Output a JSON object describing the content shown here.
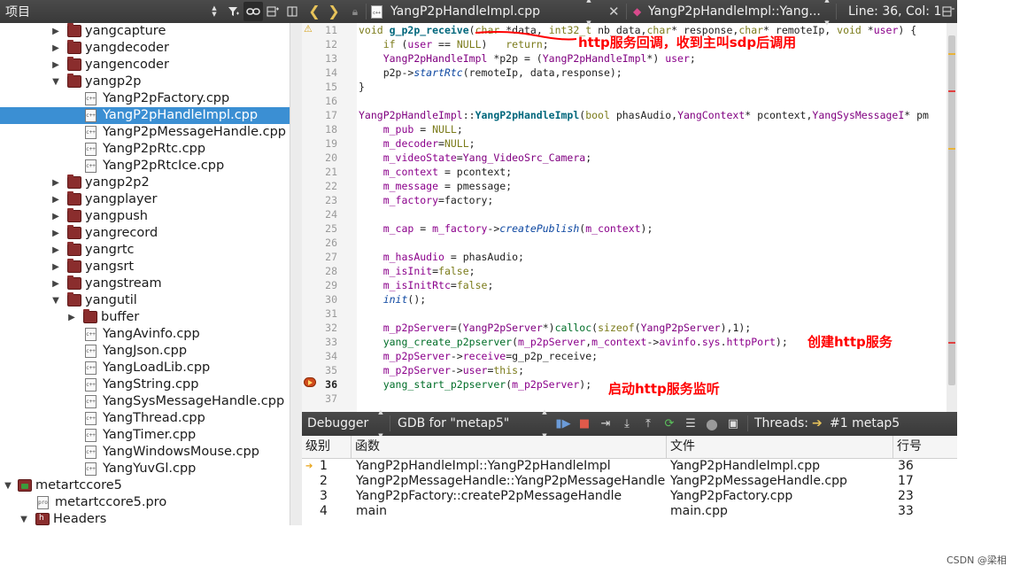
{
  "project_pane": {
    "title": "项目",
    "tree": [
      {
        "label": "yangcapture",
        "type": "folder",
        "depth": 1,
        "expanded": false
      },
      {
        "label": "yangdecoder",
        "type": "folder",
        "depth": 1,
        "expanded": false
      },
      {
        "label": "yangencoder",
        "type": "folder",
        "depth": 1,
        "expanded": false
      },
      {
        "label": "yangp2p",
        "type": "folder",
        "depth": 1,
        "expanded": true
      },
      {
        "label": "YangP2pFactory.cpp",
        "type": "file",
        "depth": 2
      },
      {
        "label": "YangP2pHandleImpl.cpp",
        "type": "file",
        "depth": 2,
        "selected": true
      },
      {
        "label": "YangP2pMessageHandle.cpp",
        "type": "file",
        "depth": 2
      },
      {
        "label": "YangP2pRtc.cpp",
        "type": "file",
        "depth": 2
      },
      {
        "label": "YangP2pRtcIce.cpp",
        "type": "file",
        "depth": 2
      },
      {
        "label": "yangp2p2",
        "type": "folder",
        "depth": 1,
        "expanded": false
      },
      {
        "label": "yangplayer",
        "type": "folder",
        "depth": 1,
        "expanded": false
      },
      {
        "label": "yangpush",
        "type": "folder",
        "depth": 1,
        "expanded": false
      },
      {
        "label": "yangrecord",
        "type": "folder",
        "depth": 1,
        "expanded": false
      },
      {
        "label": "yangrtc",
        "type": "folder",
        "depth": 1,
        "expanded": false
      },
      {
        "label": "yangsrt",
        "type": "folder",
        "depth": 1,
        "expanded": false
      },
      {
        "label": "yangstream",
        "type": "folder",
        "depth": 1,
        "expanded": false
      },
      {
        "label": "yangutil",
        "type": "folder",
        "depth": 1,
        "expanded": true
      },
      {
        "label": "buffer",
        "type": "folder",
        "depth": 2,
        "expanded": false
      },
      {
        "label": "YangAvinfo.cpp",
        "type": "file",
        "depth": 2
      },
      {
        "label": "YangJson.cpp",
        "type": "file",
        "depth": 2
      },
      {
        "label": "YangLoadLib.cpp",
        "type": "file",
        "depth": 2
      },
      {
        "label": "YangString.cpp",
        "type": "file",
        "depth": 2
      },
      {
        "label": "YangSysMessageHandle.cpp",
        "type": "file",
        "depth": 2
      },
      {
        "label": "YangThread.cpp",
        "type": "file",
        "depth": 2
      },
      {
        "label": "YangTimer.cpp",
        "type": "file",
        "depth": 2
      },
      {
        "label": "YangWindowsMouse.cpp",
        "type": "file",
        "depth": 2
      },
      {
        "label": "YangYuvGl.cpp",
        "type": "file",
        "depth": 2
      },
      {
        "label": "metartccore5",
        "type": "project",
        "depth": 0,
        "expanded": true
      },
      {
        "label": "metartccore5.pro",
        "type": "pro",
        "depth": 1
      },
      {
        "label": "Headers",
        "type": "headers",
        "depth": 1,
        "expanded": true
      }
    ]
  },
  "editor": {
    "file_tab": "YangP2pHandleImpl.cpp",
    "symbol": "YangP2pHandleImpl::Yang...",
    "position": "Line: 36, Col: 1",
    "lines": [
      {
        "no": "11",
        "text": "void g_p2p_receive(char *data, int32_t nb_data,char* response,char* remoteIp, void *user) {"
      },
      {
        "no": "12",
        "text": "    if (user == NULL)   return;"
      },
      {
        "no": "13",
        "text": "    YangP2pHandleImpl *p2p = (YangP2pHandleImpl*) user;"
      },
      {
        "no": "14",
        "text": "    p2p->startRtc(remoteIp, data,response);"
      },
      {
        "no": "15",
        "text": "}"
      },
      {
        "no": "16",
        "text": ""
      },
      {
        "no": "17",
        "text": "YangP2pHandleImpl::YangP2pHandleImpl(bool phasAudio,YangContext* pcontext,YangSysMessageI* pm"
      },
      {
        "no": "18",
        "text": "    m_pub = NULL;"
      },
      {
        "no": "19",
        "text": "    m_decoder=NULL;"
      },
      {
        "no": "20",
        "text": "    m_videoState=Yang_VideoSrc_Camera;"
      },
      {
        "no": "21",
        "text": "    m_context = pcontext;"
      },
      {
        "no": "22",
        "text": "    m_message = pmessage;"
      },
      {
        "no": "23",
        "text": "    m_factory=factory;"
      },
      {
        "no": "24",
        "text": ""
      },
      {
        "no": "25",
        "text": "    m_cap = m_factory->createPublish(m_context);"
      },
      {
        "no": "26",
        "text": ""
      },
      {
        "no": "27",
        "text": "    m_hasAudio = phasAudio;"
      },
      {
        "no": "28",
        "text": "    m_isInit=false;"
      },
      {
        "no": "29",
        "text": "    m_isInitRtc=false;"
      },
      {
        "no": "30",
        "text": "    init();"
      },
      {
        "no": "31",
        "text": ""
      },
      {
        "no": "32",
        "text": "    m_p2pServer=(YangP2pServer*)calloc(sizeof(YangP2pServer),1);"
      },
      {
        "no": "33",
        "text": "    yang_create_p2pserver(m_p2pServer,m_context->avinfo.sys.httpPort);"
      },
      {
        "no": "34",
        "text": "    m_p2pServer->receive=g_p2p_receive;"
      },
      {
        "no": "35",
        "text": "    m_p2pServer->user=this;"
      },
      {
        "no": "36",
        "text": "    yang_start_p2pserver(m_p2pServer);"
      },
      {
        "no": "37",
        "text": ""
      }
    ],
    "annotations": {
      "callback": "http服务回调，收到主叫sdp后调用",
      "create": "创建http服务",
      "start": "启动http服务监听"
    }
  },
  "debugger": {
    "mode": "Debugger",
    "engine": "GDB for \"metap5\"",
    "threads_label": "Threads:",
    "thread": "#1 metap5",
    "columns": [
      "级别",
      "函数",
      "文件",
      "行号"
    ],
    "frames": [
      {
        "level": "1",
        "function": "YangP2pHandleImpl::YangP2pHandleImpl",
        "file": "YangP2pHandleImpl.cpp",
        "line": "36"
      },
      {
        "level": "2",
        "function": "YangP2pMessageHandle::YangP2pMessageHandle",
        "file": "YangP2pMessageHandle.cpp",
        "line": "17"
      },
      {
        "level": "3",
        "function": "YangP2pFactory::createP2pMessageHandle",
        "file": "YangP2pFactory.cpp",
        "line": "23"
      },
      {
        "level": "4",
        "function": "main",
        "file": "main.cpp",
        "line": "33"
      }
    ]
  },
  "watermark": "CSDN @梁相"
}
